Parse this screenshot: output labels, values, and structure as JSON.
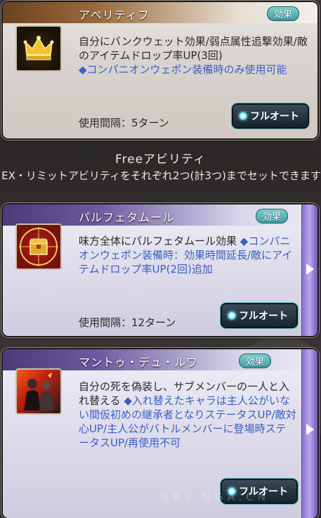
{
  "abilities_top": {
    "name": "アペリティフ",
    "badge": "効果",
    "desc_main": "自分にバンクウェット効果/弱点属性追撃効果/敵のアイテムドロップ率UP(3回)",
    "desc_note": "◆コンパニオンウェポン装備時のみ使用可能",
    "interval": "使用間隔：5ターン",
    "button": "フルオート",
    "icon": "crown-icon"
  },
  "section": {
    "title": "Freeアビリティ",
    "note": "EX・リミットアビリティをそれぞれ2つ(計3つ)までセットできます"
  },
  "abilities": [
    {
      "name": "パルフェタムール",
      "badge": "効果",
      "desc_main": "味方全体にパルフェタムール効果",
      "desc_note": "◆コンパニオンウェポン装備時：効果時間延長/敵にアイテムドロップ率UP(2回)追加",
      "interval": "使用間隔：12ターン",
      "button": "フルオート",
      "icon": "treasure-chest-icon"
    },
    {
      "name": "マントゥ・デュ・ルワ",
      "badge": "効果",
      "desc_main": "自分の死を偽装し、サブメンバーの一人と入れ替える",
      "desc_note": "◆入れ替えたキャラは主人公がいない間仮初めの継承者となりステータスUP/敵対心UP/主人公がバトルメンバーに登場時ステータスUP/再使用不可",
      "button": "フルオート",
      "icon": "character-swap-icon"
    }
  ],
  "watermark": "BBS.NGA.CN"
}
